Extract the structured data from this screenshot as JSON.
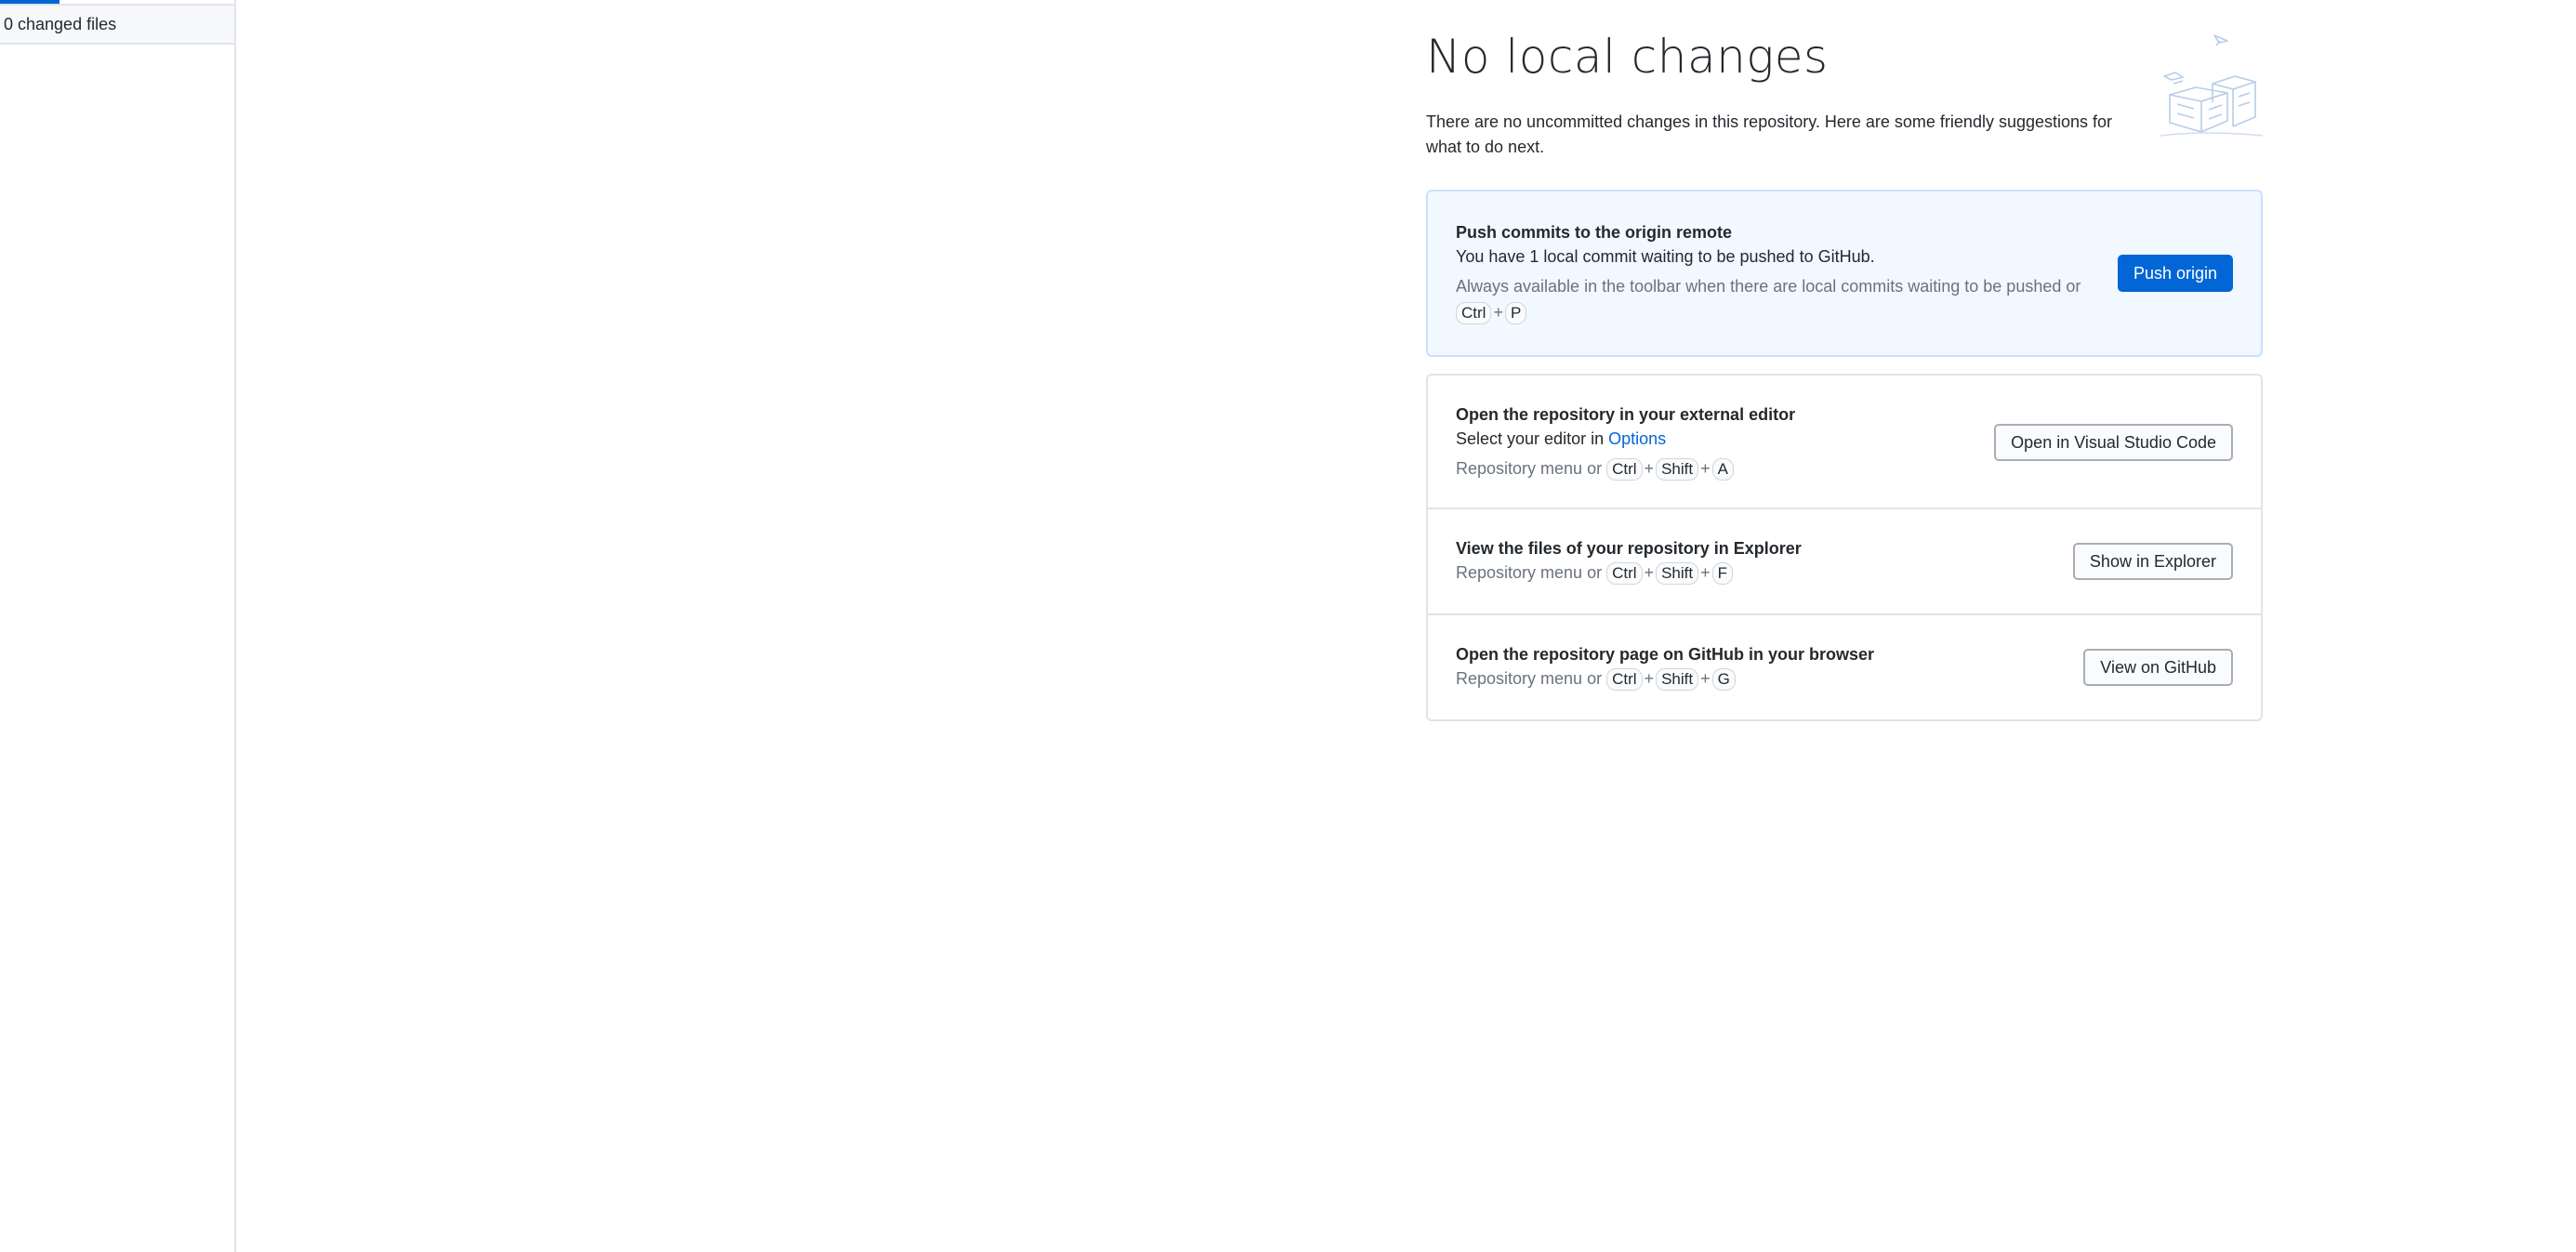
{
  "sidebar": {
    "changed_files_label": "0 changed files"
  },
  "main": {
    "title": "No local changes",
    "subtitle": "There are no uncommitted changes in this repository. Here are some friendly suggestions for what to do next."
  },
  "push_card": {
    "title": "Push commits to the origin remote",
    "description": "You have 1 local commit waiting to be pushed to GitHub.",
    "hint": "Always available in the toolbar when there are local commits waiting to be pushed or",
    "shortcut": [
      "Ctrl",
      "P"
    ],
    "button_label": "Push origin"
  },
  "editor_row": {
    "title": "Open the repository in your external editor",
    "description_prefix": "Select your editor in",
    "options_link": "Options",
    "hint": "Repository menu or",
    "shortcut": [
      "Ctrl",
      "Shift",
      "A"
    ],
    "button_label": "Open in Visual Studio Code"
  },
  "explorer_row": {
    "title": "View the files of your repository in Explorer",
    "hint": "Repository menu or",
    "shortcut": [
      "Ctrl",
      "Shift",
      "F"
    ],
    "button_label": "Show in Explorer"
  },
  "github_row": {
    "title": "Open the repository page on GitHub in your browser",
    "hint": "Repository menu or",
    "shortcut": [
      "Ctrl",
      "Shift",
      "G"
    ],
    "button_label": "View on GitHub"
  },
  "colors": {
    "accent": "#0366d6",
    "primary_card_bg": "#f1f8ff",
    "border": "#e1e4e8",
    "muted_text": "#6a737d"
  },
  "plus_sign": "+"
}
